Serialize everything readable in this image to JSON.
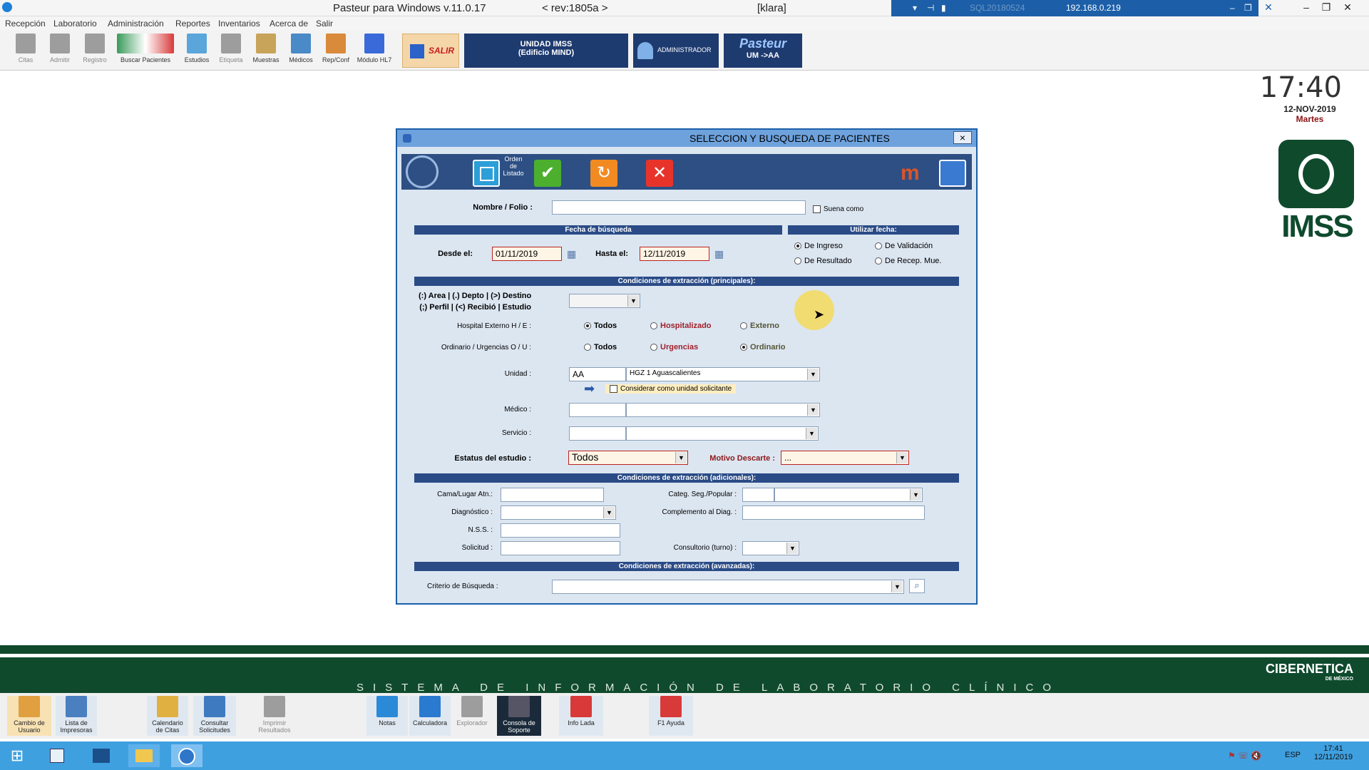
{
  "window": {
    "title": "Pasteur para Windows   v.11.0.17",
    "rev": "< rev:1805a >",
    "user": "[klara]",
    "remote_sql": "SQL20180524",
    "remote_ip": "192.168.0.219"
  },
  "menu": [
    "Recepción",
    "Laboratorio",
    "Administración",
    "Reportes",
    "Inventarios",
    "Acerca de",
    "Salir"
  ],
  "toolbar": {
    "buttons": [
      "Citas",
      "Admitir",
      "Registro",
      "Buscar Pacientes",
      "Estudios",
      "Etiqueta",
      "Muestras",
      "Médicos",
      "Rep/Conf",
      "Módulo HL7"
    ],
    "salir": "SALIR",
    "unidad_line1": "UNIDAD IMSS",
    "unidad_line2": "(Edificio MIND)",
    "admin": "ADMINISTRADOR",
    "pasteur": "Pasteur",
    "um": "UM ->AA"
  },
  "clock": {
    "time": "17:40",
    "date": "12-NOV-2019",
    "day": "Martes"
  },
  "logo": "IMSS",
  "dialog": {
    "title": "SELECCION Y BUSQUEDA DE PACIENTES",
    "close": "×",
    "orden": "Orden de Listado",
    "nombre_label": "Nombre / Folio :",
    "nombre_value": "",
    "suena_como": "Suena como",
    "fecha_band": "Fecha  de  búsqueda",
    "utilizar_band": "Utilizar fecha:",
    "desde_label": "Desde el:",
    "desde_value": "01/11/2019",
    "hasta_label": "Hasta  el:",
    "hasta_value": "12/11/2019",
    "fecha_opts": [
      "De Ingreso",
      "De Validación",
      "De Resultado",
      "De Recep. Mue."
    ],
    "cond_principal": "Condiciones de extracción (principales):",
    "area_line1": "(:) Area   |  (.) Depto  |  (>) Destino",
    "area_line2": "(;) Perfil  |   (<) Recibió  |  Estudio",
    "hosp_label": "Hospital Externo H / E :",
    "hosp_opts": [
      "Todos",
      "Hospitalizado",
      "Externo"
    ],
    "ord_label": "Ordinario / Urgencias O / U :",
    "ord_opts": [
      "Todos",
      "Urgencias",
      "Ordinario"
    ],
    "unidad_label": "Unidad :",
    "unidad_code": "AA",
    "unidad_name": "HGZ 1 Aguascalientes",
    "considerar": "Considerar como unidad solicitante",
    "medico_label": "Médico :",
    "servicio_label": "Servicio :",
    "estatus_label": "Estatus del estudio :",
    "estatus_value": "Todos",
    "motivo_label": "Motivo Descarte :",
    "motivo_value": "...",
    "cond_adicional": "Condiciones de extracción (adicionales):",
    "cama_label": "Cama/Lugar Atn.:",
    "categ_label": "Categ. Seg./Popular :",
    "diag_label": "Diagnóstico :",
    "comp_label": "Complemento al Diag. :",
    "nss_label": "N.S.S. :",
    "solicitud_label": "Solicitud :",
    "consultorio_label": "Consultorio (turno) :",
    "cond_avanzada": "Condiciones de extracción (avanzadas):",
    "criterio_label": "Criterio de Búsqueda :"
  },
  "footer": {
    "slogan": "SISTEMA DE INFORMACIÓN DE LABORATORIO CLÍNICO",
    "brand": "CIBERNETICA",
    "brand_sub": "DE MÉXICO"
  },
  "bottom_toolbar": [
    {
      "line1": "Cambio de",
      "line2": "Usuario"
    },
    {
      "line1": "Lista de",
      "line2": "Impresoras"
    },
    {
      "line1": "Calendario",
      "line2": "de Citas"
    },
    {
      "line1": "Consultar",
      "line2": "Solicitudes"
    },
    {
      "line1": "Imprimir",
      "line2": "Resultados"
    },
    {
      "line1": "Notas",
      "line2": ""
    },
    {
      "line1": "Calculadora",
      "line2": ""
    },
    {
      "line1": "Explorador",
      "line2": ""
    },
    {
      "line1": "Consola de",
      "line2": "Soporte"
    },
    {
      "line1": "Info Lada",
      "line2": ""
    },
    {
      "line1": "F1 Ayuda",
      "line2": ""
    }
  ],
  "taskbar": {
    "lang": "ESP",
    "time": "17:41",
    "date": "12/11/2019"
  }
}
